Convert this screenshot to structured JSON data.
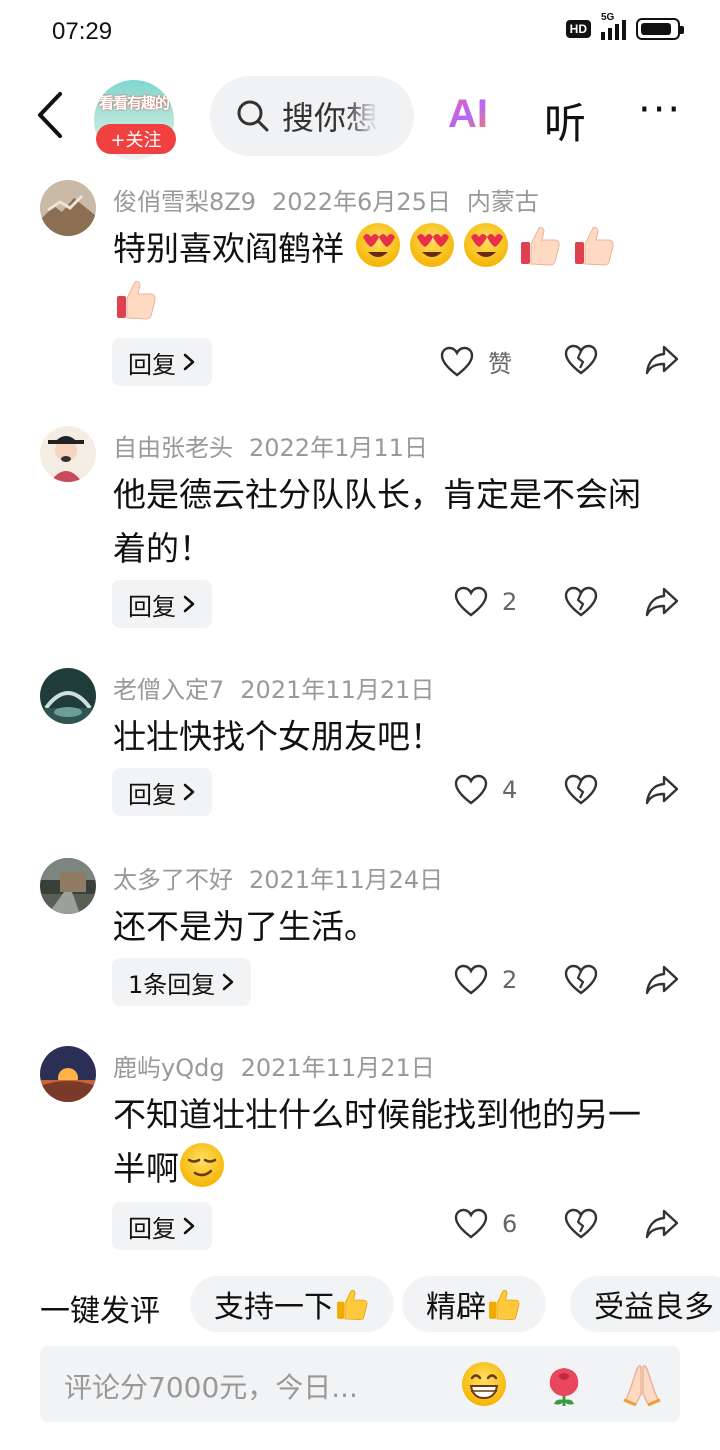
{
  "status_bar": {
    "time": "07:29",
    "hd": "HD",
    "network": "5G"
  },
  "header": {
    "channel_avatar_text": "看看有趣的",
    "follow_label": "+关注",
    "search_placeholder": "搜你想",
    "ai_label": "AI",
    "listen_label": "听",
    "more_label": "···"
  },
  "comments": [
    {
      "user": "俊俏雪梨8Z9",
      "date": "2022年6月25日",
      "location": "内蒙古",
      "text": "特别喜欢阎鹤祥",
      "emojis": [
        "heart-eyes-emoji",
        "heart-eyes-emoji",
        "heart-eyes-emoji",
        "thumbs-up-emoji",
        "thumbs-up-emoji",
        "thumbs-up-emoji"
      ],
      "reply_label": "回复",
      "like_label": "赞"
    },
    {
      "user": "自由张老头",
      "date": "2022年1月11日",
      "text": "他是德云社分队队长，肯定是不会闲着的！",
      "reply_label": "回复",
      "likes": "2"
    },
    {
      "user": "老僧入定7",
      "date": "2021年11月21日",
      "text": "壮壮快找个女朋友吧！",
      "reply_label": "回复",
      "likes": "4"
    },
    {
      "user": "太多了不好",
      "date": "2021年11月24日",
      "text": "还不是为了生活。",
      "reply_label": "1条回复",
      "likes": "2"
    },
    {
      "user": "鹿屿yQdg",
      "date": "2021年11月21日",
      "text": "不知道壮壮什么时候能找到他的另一半啊",
      "emojis": [
        "smirk-emoji"
      ],
      "reply_label": "回复",
      "likes": "6"
    }
  ],
  "quick_comment": {
    "title": "一键发评",
    "chips": [
      "支持一下",
      "精辟",
      "受益良多"
    ]
  },
  "input": {
    "placeholder": "评论分7000元，今日...",
    "emojis": [
      "grin-emoji",
      "rose-emoji",
      "pray-emoji"
    ]
  },
  "colors": {
    "follow": "#f04040",
    "meta": "#999999",
    "chip_bg": "#f2f3f5"
  }
}
